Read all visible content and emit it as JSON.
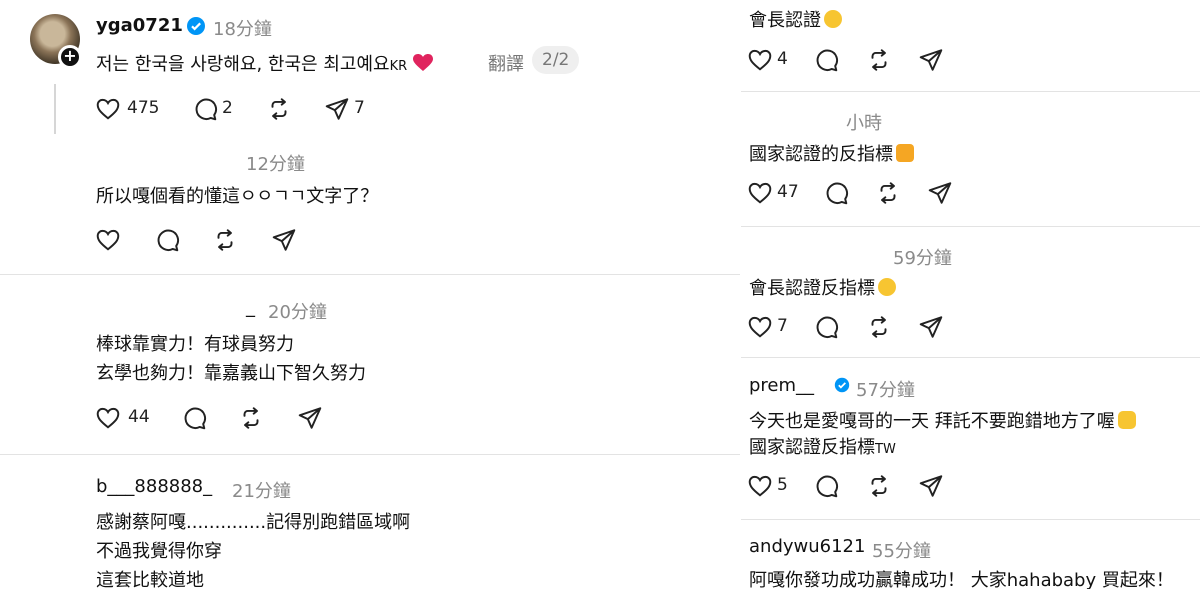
{
  "left": {
    "post": {
      "username": "yga0721",
      "time": "18分鐘",
      "text": "저는 한국을 사랑해요, 한국은 최고예요",
      "flag": "KR",
      "translate": "翻譯",
      "page": "2/2",
      "likes": "475",
      "comments": "2",
      "shares": "7"
    },
    "comments": [
      {
        "time": "12分鐘",
        "lines": [
          "所以嘎個看的懂這ㅇㅇㄱㄱ文字了？"
        ]
      },
      {
        "user": "_",
        "time": "20分鐘",
        "lines": [
          "棒球靠實力！有球員努力",
          "玄學也夠力！靠嘉義山下智久努力"
        ],
        "likes": "44"
      },
      {
        "user": "b___888888_",
        "time": "21分鐘",
        "lines": [
          "感謝蔡阿嘎..............記得別跑錯區域啊",
          "不過我覺得你穿",
          "這套比較道地"
        ]
      }
    ]
  },
  "right": {
    "comments": [
      {
        "text": "會長認證",
        "emoji": "rofl-emoji",
        "likes": "4"
      },
      {
        "time": "小時",
        "text": "國家認證的反指標",
        "emoji": "thumbs-up-emoji",
        "likes": "47"
      },
      {
        "time": "59分鐘",
        "text": "會長認證反指標",
        "emoji": "laughing-emoji",
        "likes": "7"
      },
      {
        "user": "prem__",
        "time": "57分鐘",
        "lines": [
          "今天也是愛嘎哥的一天 拜託不要跑錯地方了喔",
          "國家認證反指標"
        ],
        "flag": "TW",
        "emoji": "heart-hands-emoji",
        "likes": "5"
      },
      {
        "user": "andywu6121",
        "time": "55分鐘",
        "text": "阿嘎你發功成功贏韓成功！ 大家hahababy 買起來！"
      }
    ]
  },
  "colors": {
    "verified": "#0095f6",
    "heart": "#e0245e",
    "divider": "#e3e3e3"
  }
}
